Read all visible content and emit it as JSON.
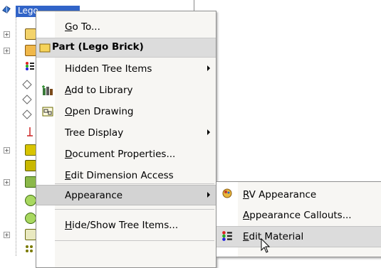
{
  "tree": {
    "root_label": "Lego Brick",
    "root_icon": "part-icon",
    "rows": [
      {
        "icon": "annotations-icon",
        "expand": "+"
      },
      {
        "icon": "material-icon",
        "expand": "+"
      },
      {
        "icon": "appearance-icon",
        "expand": ""
      },
      {
        "icon": "plane-icon",
        "expand": ""
      },
      {
        "icon": "plane-icon",
        "expand": ""
      },
      {
        "icon": "plane-icon",
        "expand": ""
      },
      {
        "icon": "origin-icon",
        "expand": ""
      },
      {
        "icon": "feature-icon",
        "expand": "+"
      },
      {
        "icon": "feature-icon",
        "expand": ""
      },
      {
        "icon": "feature-icon",
        "expand": "+"
      },
      {
        "icon": "sketch-icon",
        "expand": ""
      },
      {
        "icon": "sketch-icon",
        "expand": ""
      },
      {
        "icon": "feature-icon",
        "expand": "+"
      },
      {
        "icon": "pattern-icon",
        "expand": ""
      }
    ]
  },
  "context_menu": {
    "items": {
      "goto": {
        "label": "Go To...",
        "mnemonic": "G"
      },
      "part_header": {
        "label": "Part (Lego Brick)"
      },
      "hidden_tree_items": {
        "label": "Hidden Tree Items",
        "submenu": true
      },
      "add_to_library": {
        "label": "Add to Library",
        "mnemonic": "A",
        "icon": "add-to-library-icon"
      },
      "open_drawing": {
        "label": "Open Drawing",
        "mnemonic": "O",
        "icon": "open-drawing-icon"
      },
      "tree_display": {
        "label": "Tree Display",
        "submenu": true
      },
      "document_properties": {
        "label": "Document Properties...",
        "mnemonic": "D"
      },
      "edit_dimension_access": {
        "label": "Edit Dimension Access",
        "mnemonic": "E"
      },
      "appearance": {
        "label": "Appearance",
        "submenu": true
      },
      "hide_show_tree_items": {
        "label": "Hide/Show Tree Items...",
        "mnemonic": "H"
      }
    }
  },
  "appearance_submenu": {
    "items": {
      "rv_appearance": {
        "label": "RV Appearance",
        "mnemonic": "R",
        "icon": "rv-appearance-icon"
      },
      "appearance_callouts": {
        "label": "Appearance Callouts...",
        "mnemonic": "A"
      },
      "edit_material": {
        "label": "Edit Material",
        "mnemonic": "E",
        "icon": "edit-material-icon"
      }
    }
  },
  "colors": {
    "tree_selection": "#3164c8",
    "menu_bg": "#f7f6f3",
    "header_bg": "#dcdcdc",
    "selected_bg": "#d3d3d3"
  }
}
